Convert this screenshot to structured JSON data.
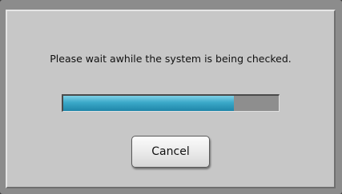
{
  "dialog": {
    "message": "Please wait awhile the system is being checked.",
    "progress_fraction": 0.79,
    "cancel_label": "Cancel"
  },
  "colors": {
    "progress_fill": "#3aa8c8",
    "progress_track": "#8e8e8e",
    "panel_background": "#c7c7c7"
  }
}
